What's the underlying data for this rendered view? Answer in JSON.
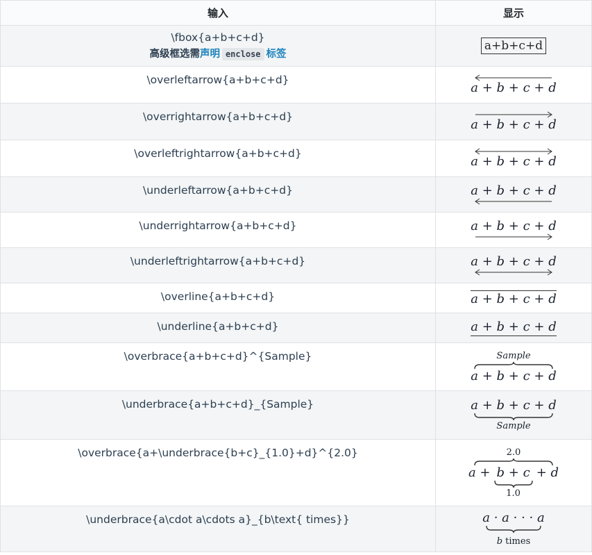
{
  "header": {
    "input": "输入",
    "output": "显示"
  },
  "rows": [
    {
      "input": "\\fbox{a+b+c+d}",
      "note_prefix": "高级框选需",
      "note_link1": "声明",
      "note_code": "enclose",
      "note_link2": "标签",
      "output": "a+b+c+d"
    },
    {
      "input": "\\overleftarrow{a+b+c+d}",
      "output": "a + b + c + d"
    },
    {
      "input": "\\overrightarrow{a+b+c+d}",
      "output": "a + b + c + d"
    },
    {
      "input": "\\overleftrightarrow{a+b+c+d}",
      "output": "a + b + c + d"
    },
    {
      "input": "\\underleftarrow{a+b+c+d}",
      "output": "a + b + c + d"
    },
    {
      "input": "\\underrightarrow{a+b+c+d}",
      "output": "a + b + c + d"
    },
    {
      "input": "\\underleftrightarrow{a+b+c+d}",
      "output": "a + b + c + d"
    },
    {
      "input": "\\overline{a+b+c+d}",
      "output": "a + b + c + d"
    },
    {
      "input": "\\underline{a+b+c+d}",
      "output": "a + b + c + d"
    },
    {
      "input": "\\overbrace{a+b+c+d}^{Sample}",
      "output": "a + b + c + d",
      "label": "Sample"
    },
    {
      "input": "\\underbrace{a+b+c+d}_{Sample}",
      "output": "a + b + c + d",
      "label": "Sample"
    },
    {
      "input": "\\overbrace{a+\\underbrace{b+c}_{1.0}+d}^{2.0}",
      "output_a": "a +",
      "output_b": "b + c",
      "output_d": "+ d",
      "label_top": "2.0",
      "label_bottom": "1.0"
    },
    {
      "input": "\\underbrace{a\\cdot a\\cdots a}_{b\\text{ times}}",
      "output": "a · a · · · a",
      "label_b": "b",
      "label_times": " times"
    }
  ]
}
